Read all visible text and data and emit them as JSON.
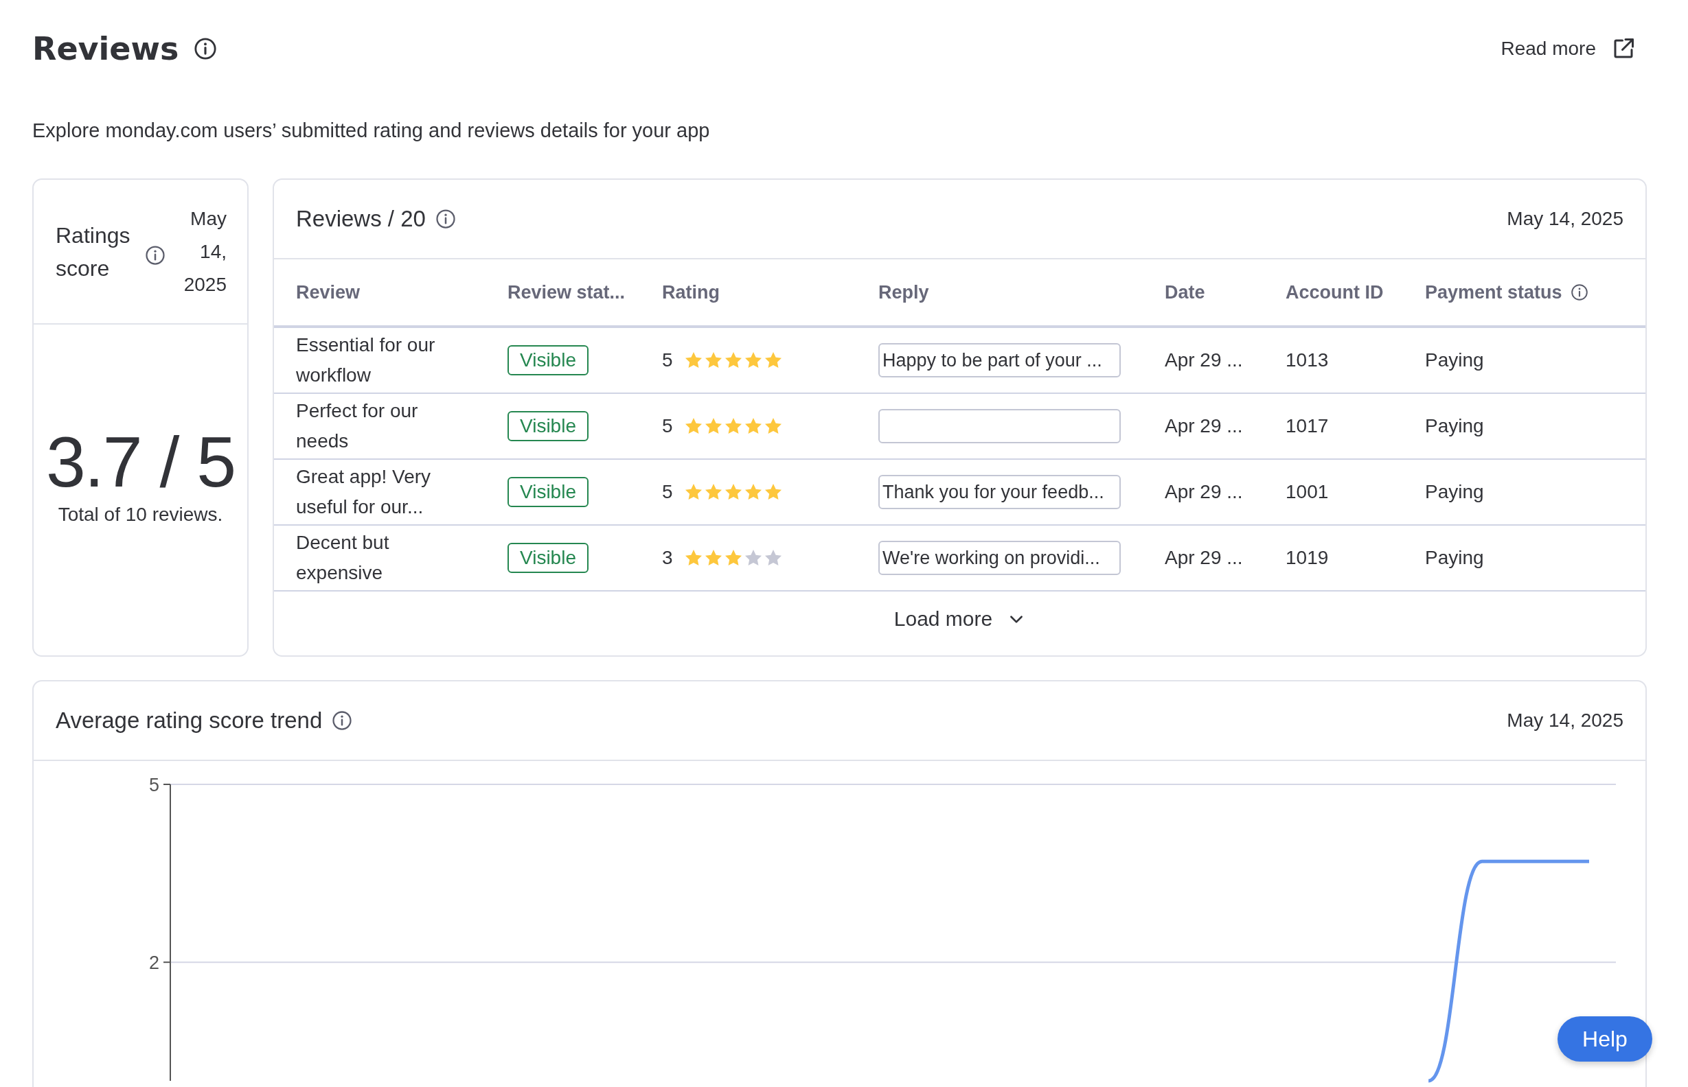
{
  "header": {
    "title": "Reviews",
    "read_more": "Read more",
    "subtitle": "Explore monday.com users’ submitted rating and reviews details for your app"
  },
  "ratings_card": {
    "title": "Ratings score",
    "date": "May 14, 2025",
    "score": "3.7 / 5",
    "total": "Total of 10 reviews."
  },
  "reviews_table": {
    "title": "Reviews / 20",
    "date": "May 14, 2025",
    "columns": [
      {
        "label": "Review",
        "info": false
      },
      {
        "label": "Review stat...",
        "info": false
      },
      {
        "label": "Rating",
        "info": false
      },
      {
        "label": "Reply",
        "info": false
      },
      {
        "label": "Date",
        "info": false
      },
      {
        "label": "Account ID",
        "info": false
      },
      {
        "label": "Payment status",
        "info": true
      }
    ],
    "rows": [
      {
        "review": "Essential for our workflow",
        "status": "Visible",
        "rating": "5",
        "stars": 5,
        "reply": "Happy to be part of your ...",
        "date": "Apr 29 ...",
        "account_id": "1013",
        "payment_status": "Paying"
      },
      {
        "review": "Perfect for our needs",
        "status": "Visible",
        "rating": "5",
        "stars": 5,
        "date": "Apr 29 ...",
        "account_id": "1017",
        "payment_status": "Paying"
      },
      {
        "review": "Great app! Very useful for our...",
        "status": "Visible",
        "rating": "5",
        "stars": 5,
        "reply": "Thank you for your feedb...",
        "date": "Apr 29 ...",
        "account_id": "1001",
        "payment_status": "Paying"
      },
      {
        "review": "Decent but expensive",
        "status": "Visible",
        "rating": "3",
        "stars": 3,
        "reply": "We're working on providi...",
        "date": "Apr 29 ...",
        "account_id": "1019",
        "payment_status": "Paying"
      }
    ],
    "load_more": "Load more"
  },
  "trend_card": {
    "title": "Average rating score trend",
    "date": "May 14, 2025",
    "chart_data": {
      "type": "line",
      "ylim": [
        0,
        5
      ],
      "yticks": [
        5,
        2
      ],
      "series": [
        {
          "color": "#6495ed",
          "values": [
            null,
            null,
            null,
            null,
            null,
            null,
            null,
            null,
            null,
            null,
            null,
            null,
            null,
            null,
            null,
            null,
            null,
            null,
            null,
            null,
            null,
            null,
            null,
            0,
            3.7,
            3.7,
            3.7
          ]
        }
      ]
    }
  },
  "help_button": "Help"
}
